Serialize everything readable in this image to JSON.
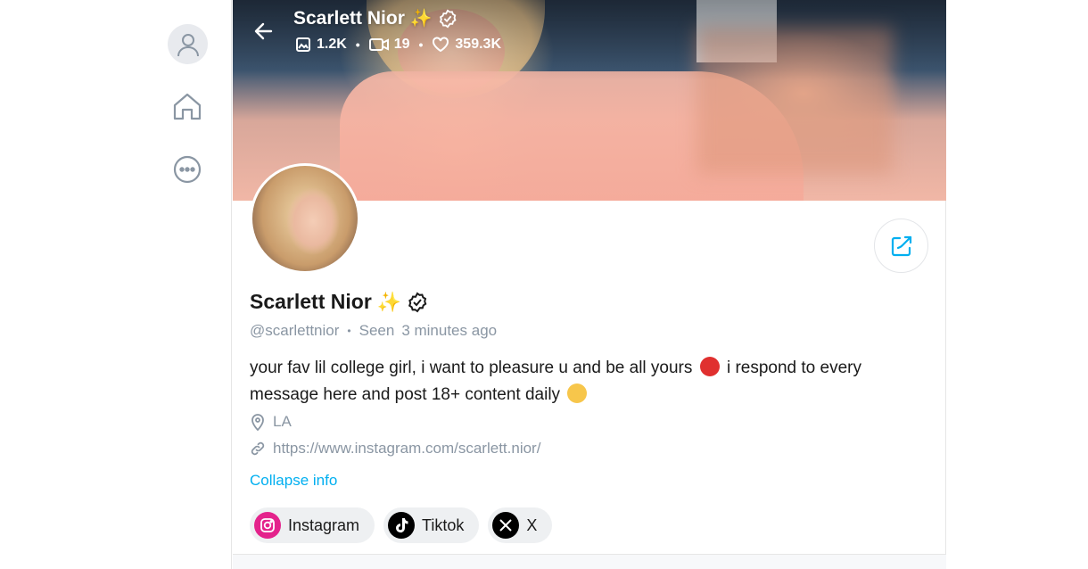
{
  "profile": {
    "name": "Scarlett Nior",
    "sparkle_emoji": "✨",
    "handle": "@scarlettnior",
    "seen_label": "Seen",
    "seen_time": "3 minutes ago",
    "bio_part1": "your fav lil college girl, i want to pleasure u and be all yours",
    "bio_part2": "i respond to every message here and post 18+ content daily",
    "location": "LA",
    "website": "https://www.instagram.com/scarlett.nior/",
    "collapse_label": "Collapse info"
  },
  "stats": {
    "photos": "1.2K",
    "videos": "19",
    "likes": "359.3K"
  },
  "socials": [
    {
      "label": "Instagram",
      "icon": "instagram-icon"
    },
    {
      "label": "Tiktok",
      "icon": "tiktok-icon"
    },
    {
      "label": "X",
      "icon": "x-icon"
    }
  ],
  "colors": {
    "accent": "#00aff0",
    "muted": "#8a96a3",
    "instagram": "#e4238c"
  }
}
